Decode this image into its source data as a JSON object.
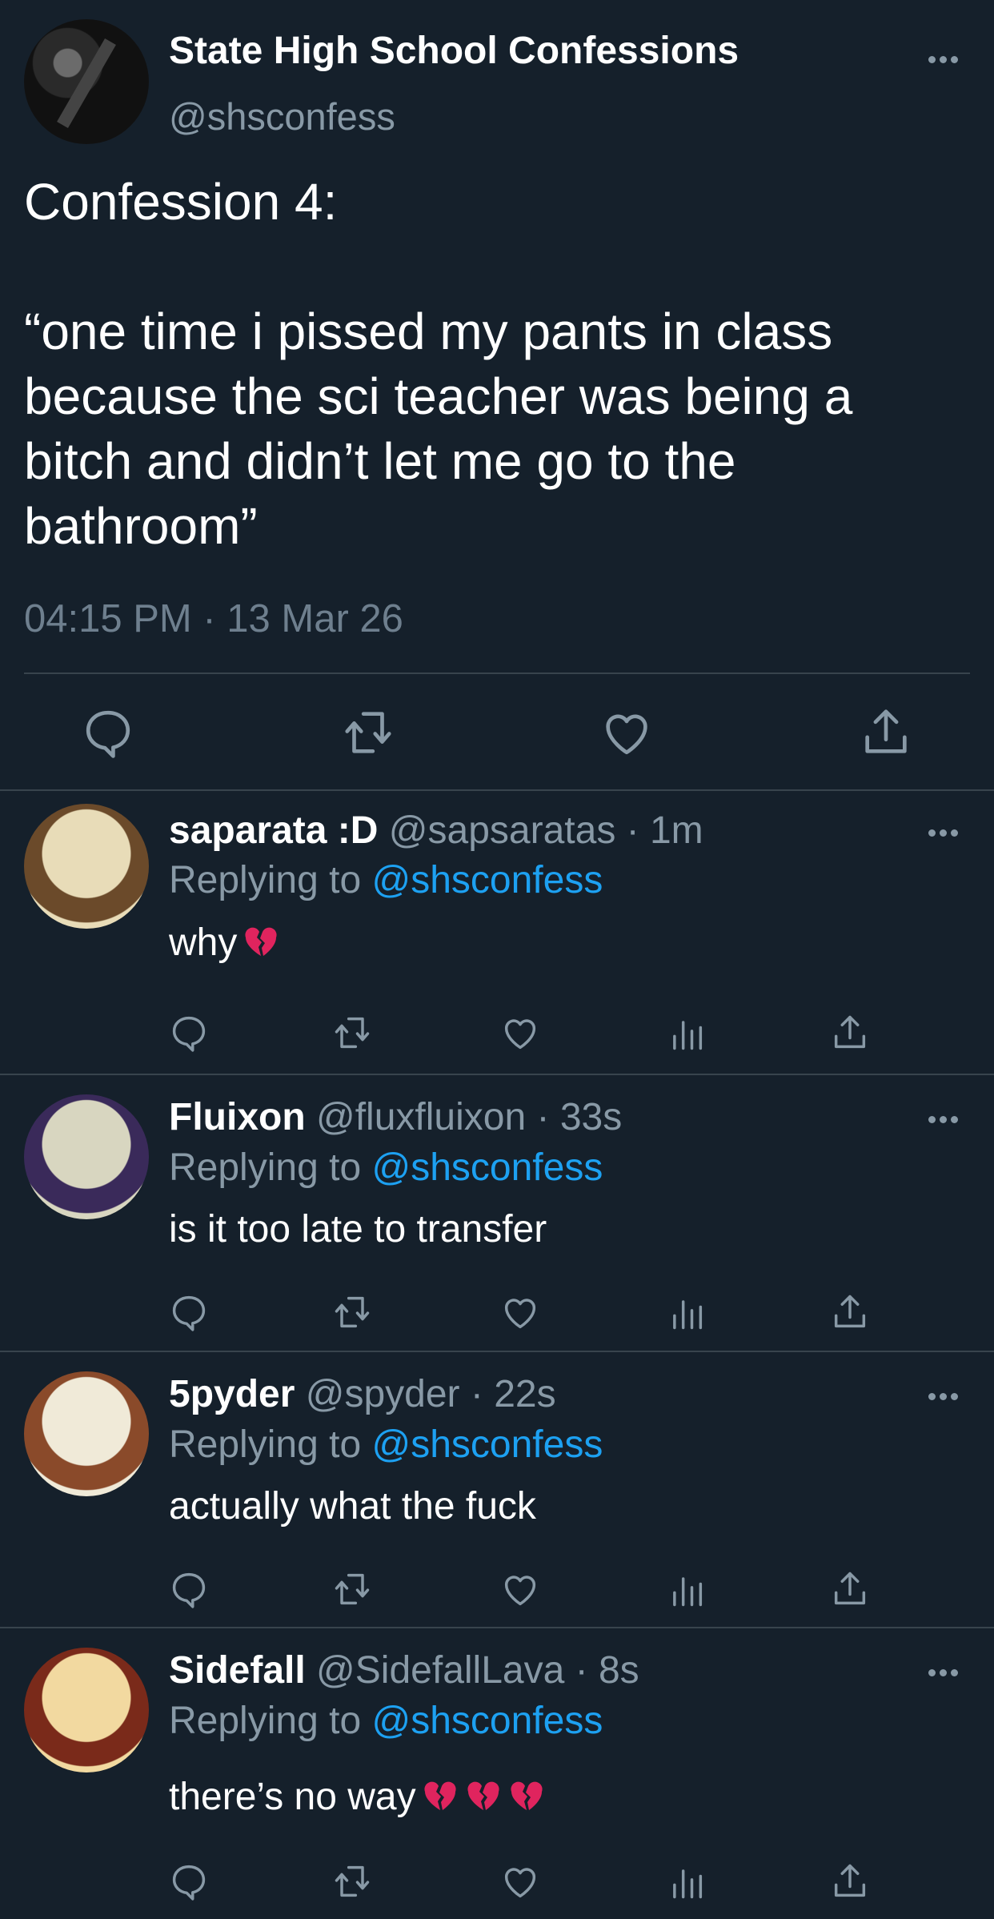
{
  "main_tweet": {
    "display_name": "State High School Confessions",
    "handle": "@shsconfess",
    "text": "Confession 4:\n\n“one time i pissed my pants in class because the sci teacher was being a bitch and didn’t let me go to the bathroom”",
    "timestamp": "04:15 PM · 13 Mar 26",
    "actions": [
      "reply-icon",
      "retweet-icon",
      "like-icon",
      "share-icon"
    ]
  },
  "replies": [
    {
      "display_name": "saparata :D",
      "meta": " @sapsaratas · 1m",
      "replying_prefix": "Replying to ",
      "replying_to": "@shsconfess",
      "text": "why",
      "emoji_count": 1,
      "avatar_colors": [
        "#e8dcb8",
        "#6b4a2a"
      ]
    },
    {
      "display_name": "Fluixon",
      "meta": " @fluxfluixon · 33s",
      "replying_prefix": "Replying to ",
      "replying_to": "@shsconfess",
      "text": "is it too late to transfer",
      "emoji_count": 0,
      "avatar_colors": [
        "#d8d6c0",
        "#3a2a5a"
      ]
    },
    {
      "display_name": "5pyder",
      "meta": " @spyder · 22s",
      "replying_prefix": "Replying to ",
      "replying_to": "@shsconfess",
      "text": "actually what the fuck",
      "emoji_count": 0,
      "avatar_colors": [
        "#f0ead8",
        "#8a4a2a"
      ]
    },
    {
      "display_name": "Sidefall",
      "meta": " @SidefallLava · 8s",
      "replying_prefix": "Replying to ",
      "replying_to": "@shsconfess",
      "text": "there’s no way",
      "emoji_count": 3,
      "avatar_colors": [
        "#f2d9a0",
        "#7a2a1a"
      ]
    }
  ],
  "reply_actions": [
    "reply-icon",
    "retweet-icon",
    "like-icon",
    "analytics-icon",
    "share-icon"
  ],
  "colors": {
    "background": "#15202b",
    "secondary_text": "#8899a6",
    "link": "#1da1f2",
    "divider": "#38444d",
    "broken_heart": "#e0245e"
  }
}
